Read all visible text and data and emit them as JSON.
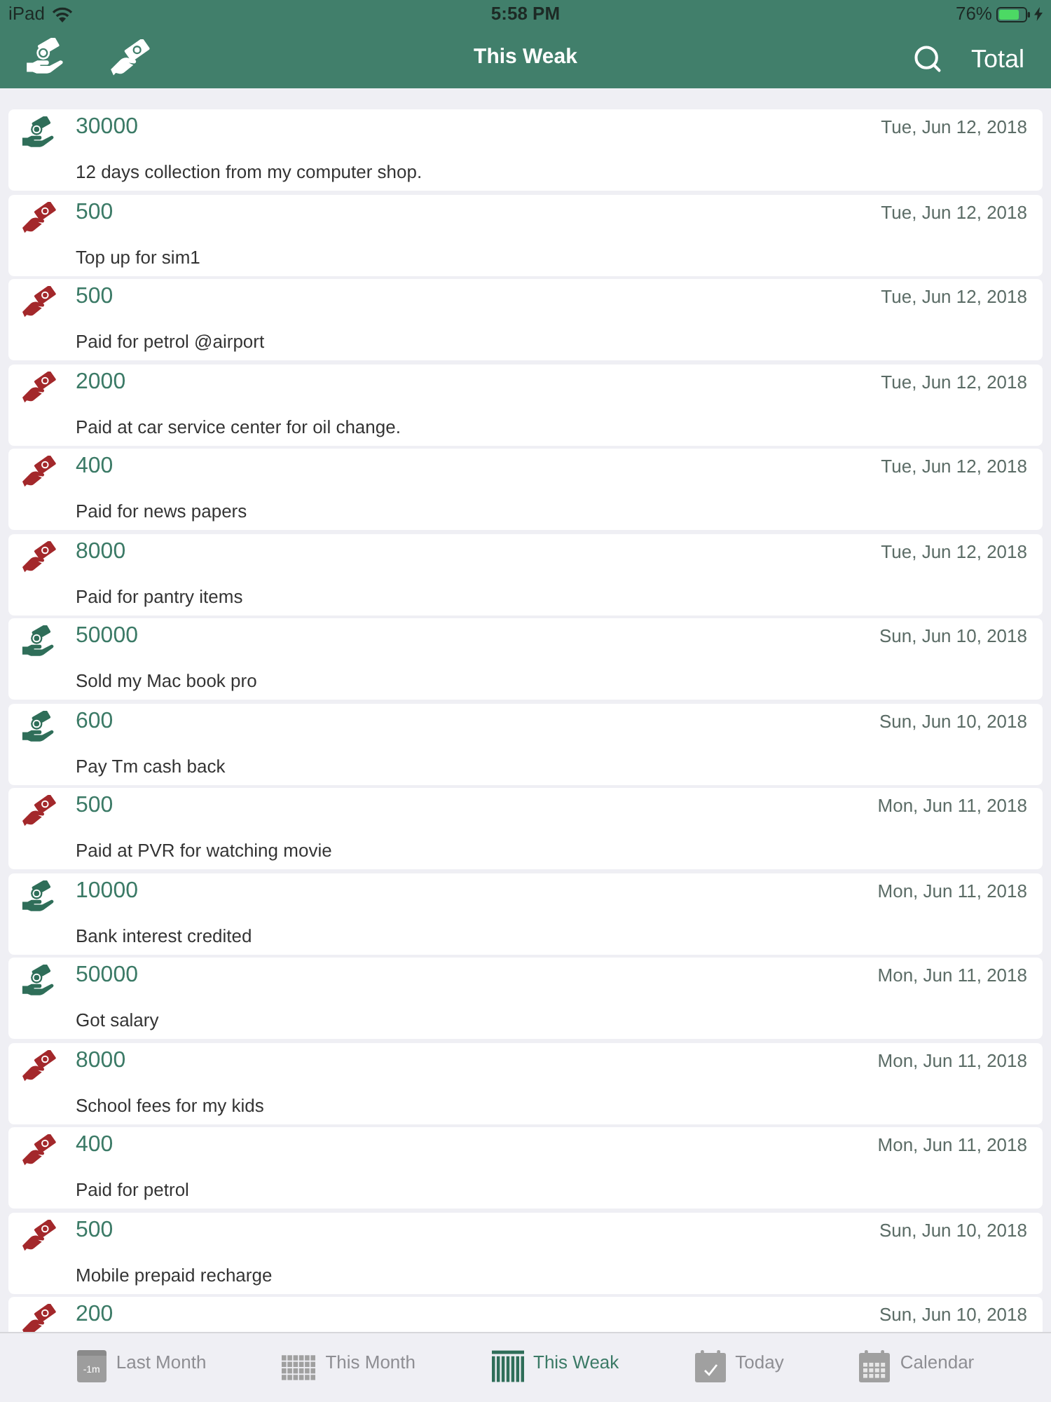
{
  "status_bar": {
    "device": "iPad",
    "time": "5:58 PM",
    "battery": "76%"
  },
  "header": {
    "title": "This Weak",
    "action": "Total"
  },
  "transactions": [
    {
      "kind": "income",
      "amount": "30000",
      "date": "Tue, Jun 12, 2018",
      "description": "12 days collection from my computer shop."
    },
    {
      "kind": "expense",
      "amount": "500",
      "date": "Tue, Jun 12, 2018",
      "description": "Top up for sim1"
    },
    {
      "kind": "expense",
      "amount": "500",
      "date": "Tue, Jun 12, 2018",
      "description": "Paid for petrol @airport"
    },
    {
      "kind": "expense",
      "amount": "2000",
      "date": "Tue, Jun 12, 2018",
      "description": "Paid at car service center for oil change."
    },
    {
      "kind": "expense",
      "amount": "400",
      "date": "Tue, Jun 12, 2018",
      "description": "Paid for news papers"
    },
    {
      "kind": "expense",
      "amount": "8000",
      "date": "Tue, Jun 12, 2018",
      "description": "Paid for pantry items"
    },
    {
      "kind": "income",
      "amount": "50000",
      "date": "Sun, Jun 10, 2018",
      "description": "Sold my Mac book pro"
    },
    {
      "kind": "income",
      "amount": "600",
      "date": "Sun, Jun 10, 2018",
      "description": "Pay Tm cash back"
    },
    {
      "kind": "expense",
      "amount": "500",
      "date": "Mon, Jun 11, 2018",
      "description": "Paid at PVR for watching movie"
    },
    {
      "kind": "income",
      "amount": "10000",
      "date": "Mon, Jun 11, 2018",
      "description": "Bank interest credited"
    },
    {
      "kind": "income",
      "amount": "50000",
      "date": "Mon, Jun 11, 2018",
      "description": "Got salary"
    },
    {
      "kind": "expense",
      "amount": "8000",
      "date": "Mon, Jun 11, 2018",
      "description": "School fees for my kids"
    },
    {
      "kind": "expense",
      "amount": "400",
      "date": "Mon, Jun 11, 2018",
      "description": "Paid for petrol"
    },
    {
      "kind": "expense",
      "amount": "500",
      "date": "Sun, Jun 10, 2018",
      "description": "Mobile prepaid recharge"
    },
    {
      "kind": "expense",
      "amount": "200",
      "date": "Sun, Jun 10, 2018"
    }
  ],
  "tabs": [
    {
      "kind": "lastmonth",
      "label": "Last Month",
      "icon_text": "-1m",
      "selected": false
    },
    {
      "kind": "month",
      "label": "This Month",
      "selected": false
    },
    {
      "kind": "week",
      "label": "This Weak",
      "selected": true
    },
    {
      "kind": "today",
      "label": "Today",
      "selected": false
    },
    {
      "kind": "calendar",
      "label": "Calendar",
      "selected": false
    }
  ]
}
